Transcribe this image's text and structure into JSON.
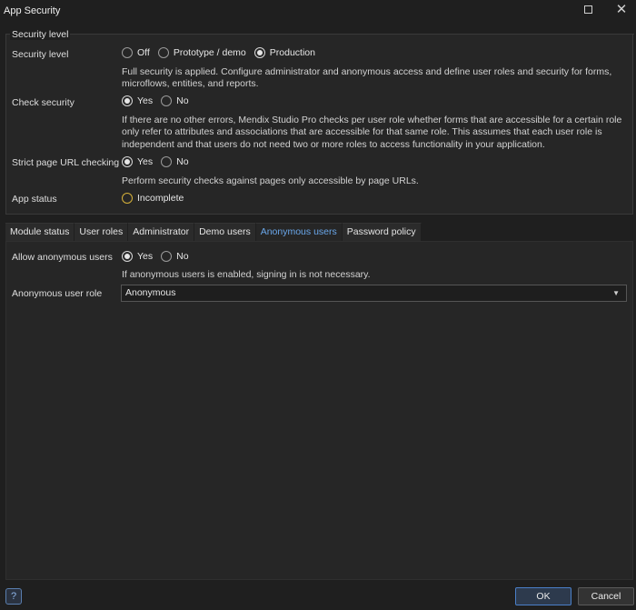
{
  "window": {
    "title": "App Security"
  },
  "security": {
    "legend": "Security level",
    "level": {
      "label": "Security level",
      "options": [
        "Off",
        "Prototype / demo",
        "Production"
      ],
      "selected": "Production",
      "help": "Full security is applied. Configure administrator and anonymous access and define user roles and security for forms, microflows, entities, and reports."
    },
    "check": {
      "label": "Check security",
      "options": [
        "Yes",
        "No"
      ],
      "selected": "Yes",
      "help": "If there are no other errors, Mendix Studio Pro checks per user role whether forms that are accessible for a certain role only refer to attributes and associations that are accessible for that same role. This assumes that each user role is independent and that users do not need two or more roles to access functionality in your application."
    },
    "strict": {
      "label": "Strict page URL checking",
      "options": [
        "Yes",
        "No"
      ],
      "selected": "Yes",
      "help": "Perform security checks against pages only accessible by page URLs."
    },
    "status": {
      "label": "App status",
      "value": "Incomplete",
      "color": "#d6b13a"
    }
  },
  "tabs": [
    "Module status",
    "User roles",
    "Administrator",
    "Demo users",
    "Anonymous users",
    "Password policy"
  ],
  "active_tab": "Anonymous users",
  "anonymous": {
    "allow_label": "Allow anonymous users",
    "options": [
      "Yes",
      "No"
    ],
    "selected": "Yes",
    "help": "If anonymous users is enabled, signing in is not necessary.",
    "role_label": "Anonymous user role",
    "role_value": "Anonymous"
  },
  "footer": {
    "ok": "OK",
    "cancel": "Cancel",
    "help_icon": "?"
  },
  "colors": {
    "accent": "#6aa7ea",
    "warning": "#d6b13a"
  }
}
